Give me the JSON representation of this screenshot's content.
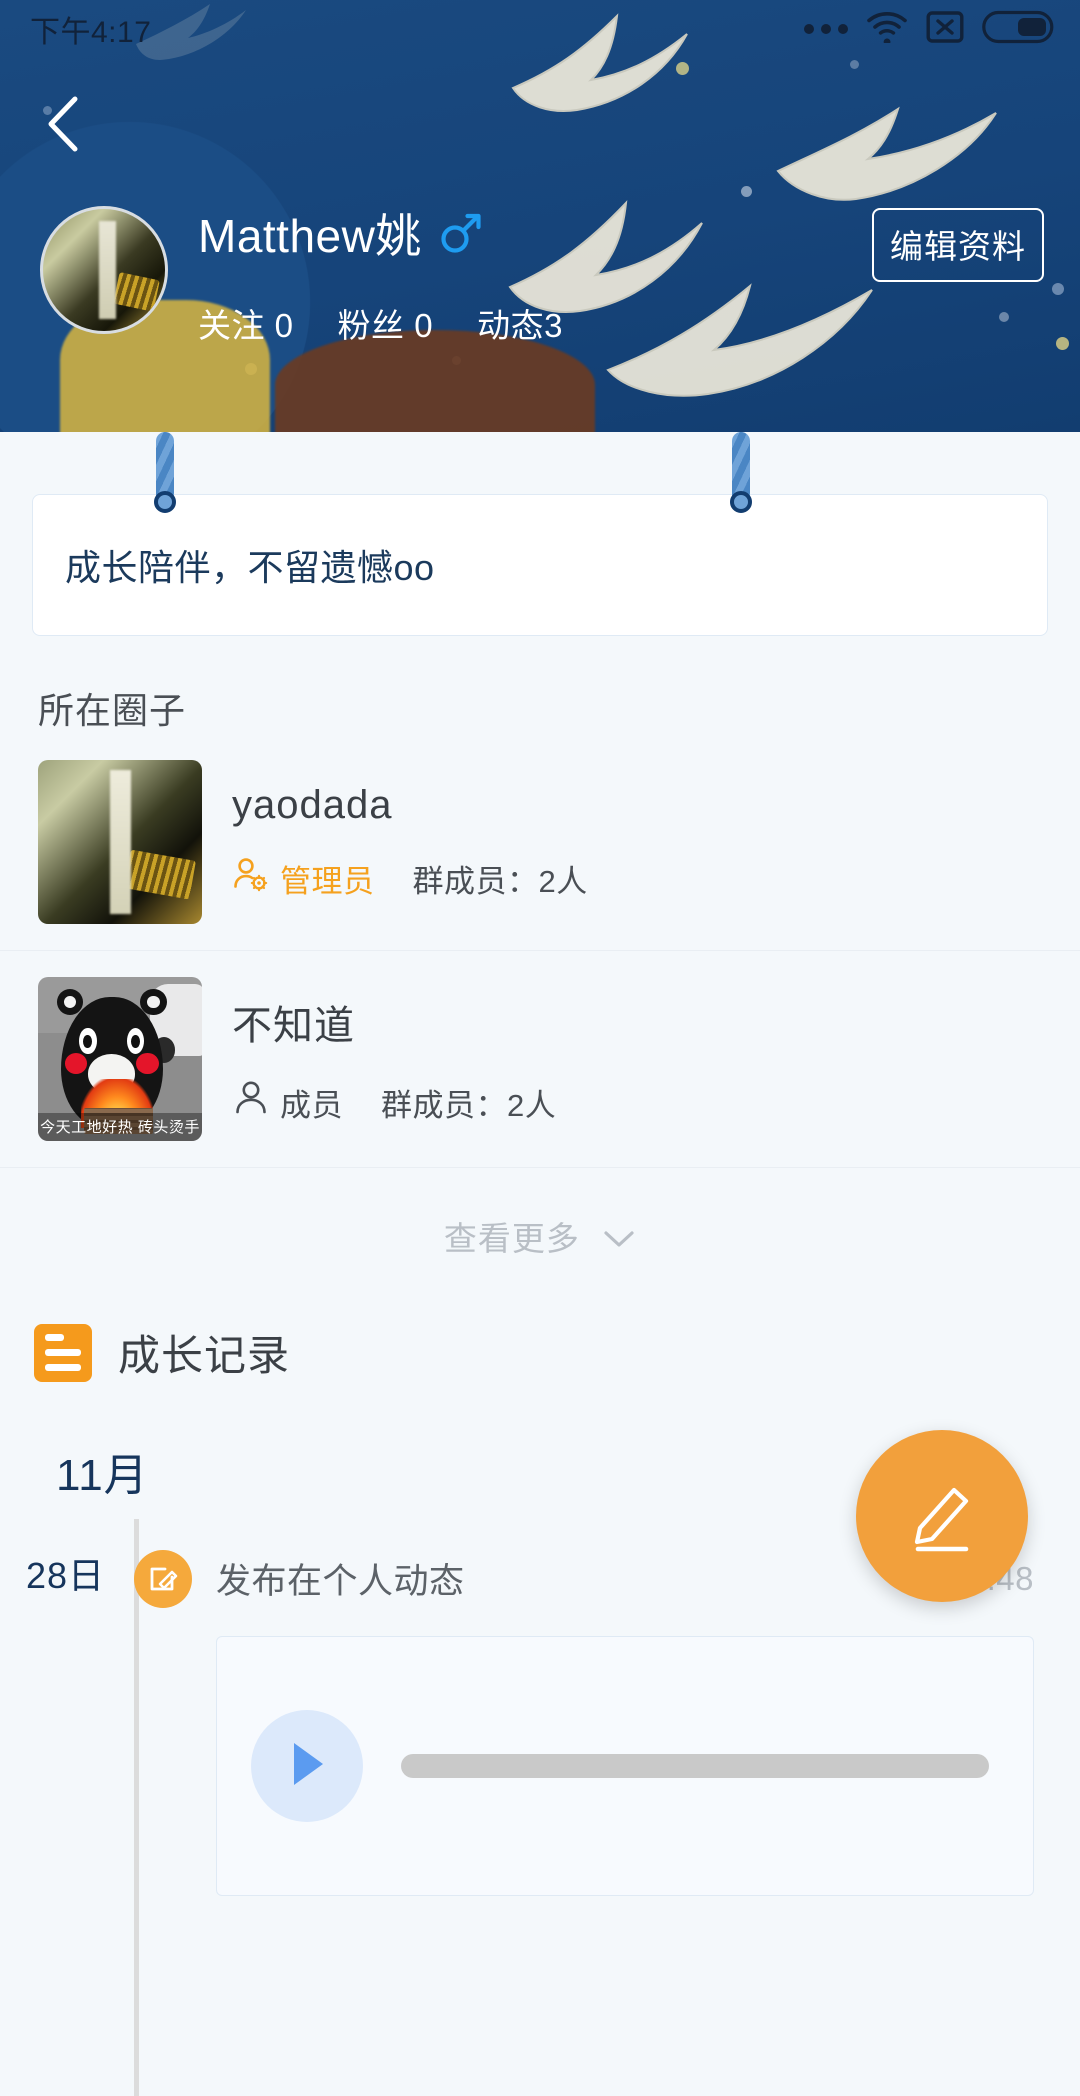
{
  "status_bar": {
    "time": "下午4:17",
    "icons": [
      "more-dots-icon",
      "wifi-icon",
      "sim-x-icon",
      "battery-icon"
    ]
  },
  "header": {
    "back_icon": "back-chevron-icon",
    "username": "Matthew姚",
    "gender_icon": "male-gender-icon",
    "edit_label": "编辑资料",
    "stats": [
      {
        "label": "关注 0"
      },
      {
        "label": "粉丝 0"
      },
      {
        "label": "动态3"
      }
    ],
    "avatar_alt": "user-avatar",
    "bg_color": "#16447a"
  },
  "bio": {
    "text": "成长陪伴，不留遗憾oo"
  },
  "groups": {
    "section_title": "所在圈子",
    "items": [
      {
        "name": "yaodada",
        "role": "管理员",
        "role_icon": "user-gear-icon",
        "members": "群成员：2人",
        "role_color": "#f5a11e",
        "thumb_caption": ""
      },
      {
        "name": "不知道",
        "role": "成员",
        "role_icon": "user-icon",
        "members": "群成员：2人",
        "role_color": "#4a4f55",
        "thumb_caption": "今天工地好热 砖头烫手"
      }
    ],
    "view_more": "查看更多",
    "view_more_icon": "chevron-down-icon"
  },
  "growth_record": {
    "title": "成长记录",
    "icon": "list-icon",
    "month": "11月",
    "entries": [
      {
        "day": "28日",
        "action": "发布在个人动态",
        "action_icon": "edit-note-icon",
        "time": "11-2     :48",
        "media": {
          "type": "audio",
          "play_icon": "play-icon",
          "progress": 0
        }
      }
    ]
  },
  "fab": {
    "icon": "pencil-icon",
    "color": "#f2a03c"
  }
}
